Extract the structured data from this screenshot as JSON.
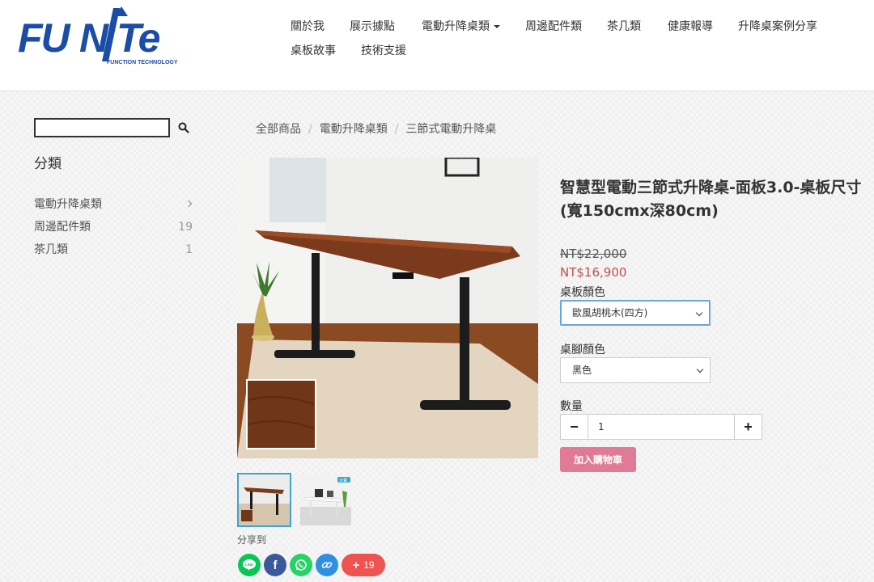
{
  "brand": {
    "logo_text": "FUNTE",
    "tagline": "FUNCTION TECHNOLOGY",
    "color": "#1a4ca8"
  },
  "nav": {
    "items": [
      {
        "label": "關於我"
      },
      {
        "label": "展示據點"
      },
      {
        "label": "電動升降桌類",
        "dropdown": true
      },
      {
        "label": "周邊配件類"
      },
      {
        "label": "茶几類"
      },
      {
        "label": "健康報導"
      },
      {
        "label": "升降桌案例分享"
      },
      {
        "label": "桌板故事"
      },
      {
        "label": "技術支援"
      }
    ]
  },
  "sidebar": {
    "search_placeholder": "",
    "category_title": "分類",
    "categories": [
      {
        "label": "電動升降桌類",
        "count": ""
      },
      {
        "label": "周邊配件類",
        "count": "19"
      },
      {
        "label": "茶几類",
        "count": "1"
      }
    ]
  },
  "breadcrumb": [
    "全部商品",
    "電動升降桌類",
    "三節式電動升降桌"
  ],
  "product": {
    "title": "智慧型電動三節式升降桌-面板3.0-桌板尺寸 (寬150cmx深80cm)",
    "price_original": "NT$22,000",
    "price_sale": "NT$16,900",
    "board_color_label": "桌板顏色",
    "board_color_value": "歐風胡桃木(四方)",
    "leg_color_label": "桌腳顏色",
    "leg_color_value": "黑色",
    "qty_label": "數量",
    "qty_value": "1",
    "add_to_cart": "加入購物車",
    "thumb_badge": "大賣"
  },
  "share": {
    "label": "分享到",
    "more_count": "19",
    "line_text": "LINE"
  },
  "colors": {
    "price_sale": "#c2504a",
    "cart_button": "#e07a97",
    "share_line": "#06c755",
    "share_facebook": "#3b5998",
    "share_whatsapp": "#25d366",
    "share_link": "#2f8fe0",
    "share_more": "#ef5350",
    "thumb_active": "#3ea3d6"
  }
}
